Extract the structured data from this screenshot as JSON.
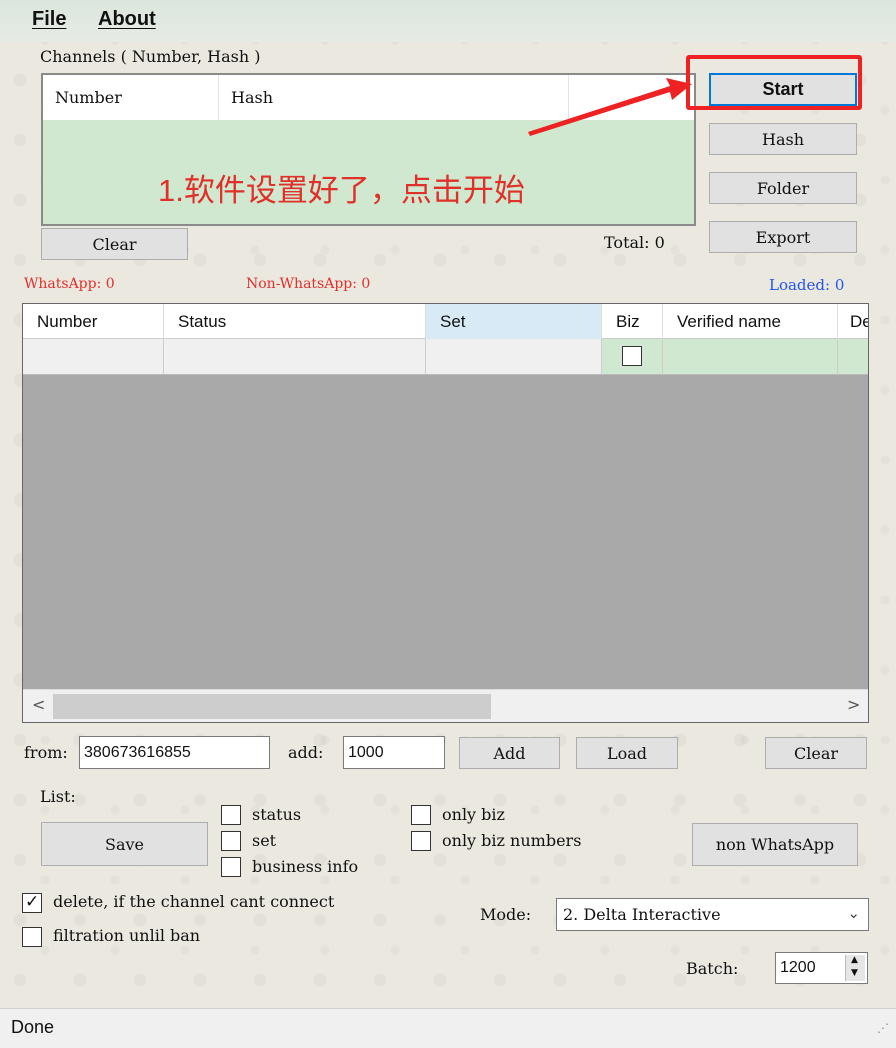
{
  "menu": {
    "file": "File",
    "about": "About"
  },
  "channels": {
    "title": "Channels ( Number, Hash )",
    "columns": [
      "Number",
      "Hash"
    ],
    "total_label": "Total: 0",
    "clear_label": "Clear"
  },
  "side_buttons": {
    "start": "Start",
    "hash": "Hash",
    "folder": "Folder",
    "export": "Export"
  },
  "annotation": "1.软件设置好了，点击开始",
  "counters": {
    "whatsapp": "WhatsApp: 0",
    "non_whatsapp": "Non-WhatsApp: 0",
    "loaded": "Loaded: 0"
  },
  "colors": {
    "counter_red": "#e0302a",
    "loaded_blue": "#2255ee",
    "accent_blue": "#0078d7",
    "highlight_red": "#ee2222"
  },
  "grid": {
    "columns": [
      "Number",
      "Status",
      "Set",
      "Biz",
      "Verified name",
      "De"
    ]
  },
  "range": {
    "from_label": "from:",
    "from_value": "380673616855",
    "add_label": "add:",
    "add_value": "1000",
    "add_button": "Add",
    "load_button": "Load",
    "clear_button": "Clear"
  },
  "list": {
    "label": "List:",
    "save_button": "Save",
    "status": "status",
    "set": "set",
    "business_info": "business info",
    "only_biz": "only biz",
    "only_biz_numbers": "only biz numbers",
    "non_whatsapp_button": "non WhatsApp"
  },
  "options": {
    "delete_if_cant_connect": "delete, if the channel cant connect",
    "filtration_until_ban": "filtration unlil ban"
  },
  "mode": {
    "label": "Mode:",
    "value": "2. Delta Interactive"
  },
  "batch": {
    "label": "Batch:",
    "value": "1200"
  },
  "status_bar": {
    "text": "Done"
  }
}
